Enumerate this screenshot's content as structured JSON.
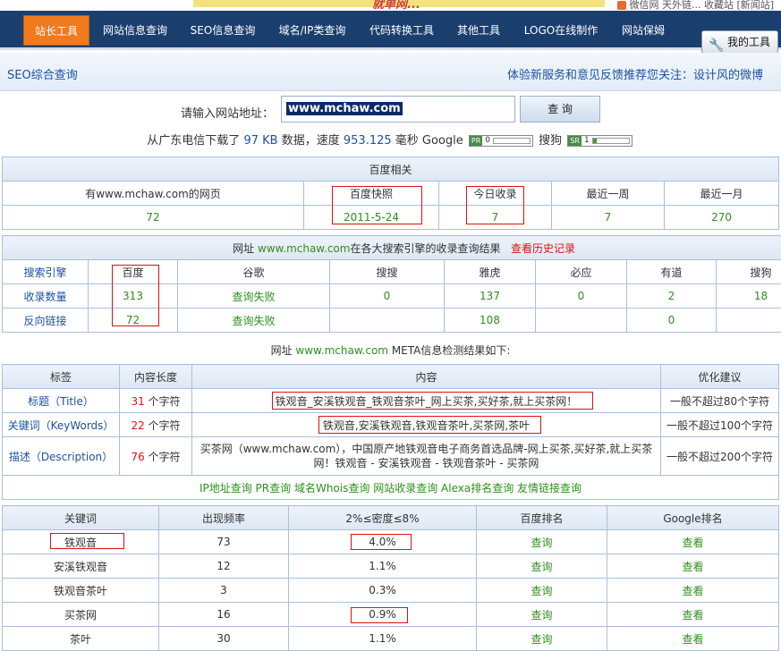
{
  "top": {
    "banner_text": "就单网...",
    "right_text": "微信网 天外链... 收藏站 [新闻站]"
  },
  "nav": {
    "items": [
      "站长工具",
      "网站信息查询",
      "SEO信息查询",
      "域名/IP类查询",
      "代码转换工具",
      "其他工具",
      "LOGO在线制作",
      "网站保姆"
    ],
    "my_tools": "我的工具"
  },
  "subbar": {
    "left": "SEO综合查询",
    "right": "体验新服务和意见反馈推荐您关注：设计风的微博"
  },
  "query": {
    "label": "请输入网站地址：",
    "value": "www.mchaw.com",
    "button": "查 询"
  },
  "download": {
    "prefix": "从广东电信下载了",
    "size": "97 KB",
    "mid": "数据，速度",
    "speed": "953.125",
    "suffix": "毫秒 Google",
    "google_pr": "0",
    "sogou_label": "搜狗",
    "sogou_pr": "1",
    "pr_tag": "PR",
    "sr_tag": "SR",
    "google_pr_fraction": 0,
    "sogou_pr_fraction": 0.1
  },
  "baidu": {
    "title": "百度相关",
    "headers": [
      "有www.mchaw.com的网页",
      "百度快照",
      "今日收录",
      "最近一周",
      "最近一月"
    ],
    "values": [
      "72",
      "2011-5-24",
      "7",
      "7",
      "270"
    ]
  },
  "engines": {
    "title_prefix": "网址",
    "title_site": "www.mchaw.com",
    "title_suffix": "在各大搜索引擎的收录查询结果",
    "history": "查看历史记录",
    "headers": [
      "搜索引擎",
      "百度",
      "谷歌",
      "搜搜",
      "雅虎",
      "必应",
      "有道",
      "搜狗"
    ],
    "rows": [
      [
        "收录数量",
        "313",
        "查询失败",
        "0",
        "137",
        "0",
        "2",
        "18"
      ],
      [
        "反向链接",
        "72",
        "查询失败",
        "",
        "108",
        "",
        "0",
        ""
      ]
    ]
  },
  "meta": {
    "title_prefix": "网址",
    "title_site": "www.mchaw.com",
    "title_suffix": "META信息检测结果如下:",
    "headers": [
      "标签",
      "内容长度",
      "内容",
      "优化建议"
    ],
    "char_unit": "个字符",
    "rows": [
      {
        "tag": "标题（Title）",
        "len": "31",
        "content": "铁观音_安溪铁观音_铁观音茶叶_网上买茶,买好茶,就上买茶网！",
        "advice": "一般不超过80个字符"
      },
      {
        "tag": "关键词（KeyWords）",
        "len": "22",
        "content": "铁观音,安溪铁观音,铁观音茶叶,买茶网,茶叶",
        "advice": "一般不超过100个字符"
      },
      {
        "tag": "描述（Description）",
        "len": "76",
        "content": "买茶网（www.mchaw.com），中国原产地铁观音电子商务首选品牌-网上买茶,买好茶,就上买茶网！铁观音 - 安溪铁观音 - 铁观音茶叶 - 买茶网",
        "advice": "一般不超过200个字符"
      }
    ],
    "links": [
      "IP地址查询",
      "PR查询",
      "域名Whois查询",
      "网站收录查询",
      "Alexa排名查询",
      "友情链接查询"
    ]
  },
  "keywords": {
    "headers": [
      "关键词",
      "出现频率",
      "2%≤密度≤8%",
      "百度排名",
      "Google排名"
    ],
    "rows": [
      [
        "铁观音",
        "73",
        "4.0%",
        "查询",
        "查看"
      ],
      [
        "安溪铁观音",
        "12",
        "1.1%",
        "查询",
        "查看"
      ],
      [
        "铁观音茶叶",
        "3",
        "0.3%",
        "查询",
        "查看"
      ],
      [
        "买茶网",
        "16",
        "0.9%",
        "查询",
        "查看"
      ],
      [
        "茶叶",
        "30",
        "1.1%",
        "查询",
        "查看"
      ]
    ]
  },
  "colors": {
    "nav_bg": "#1a3f6e",
    "nav_active": "#f07a1e",
    "link_blue": "#1c52a0",
    "green": "#2f8f1f",
    "red": "#d11111"
  }
}
